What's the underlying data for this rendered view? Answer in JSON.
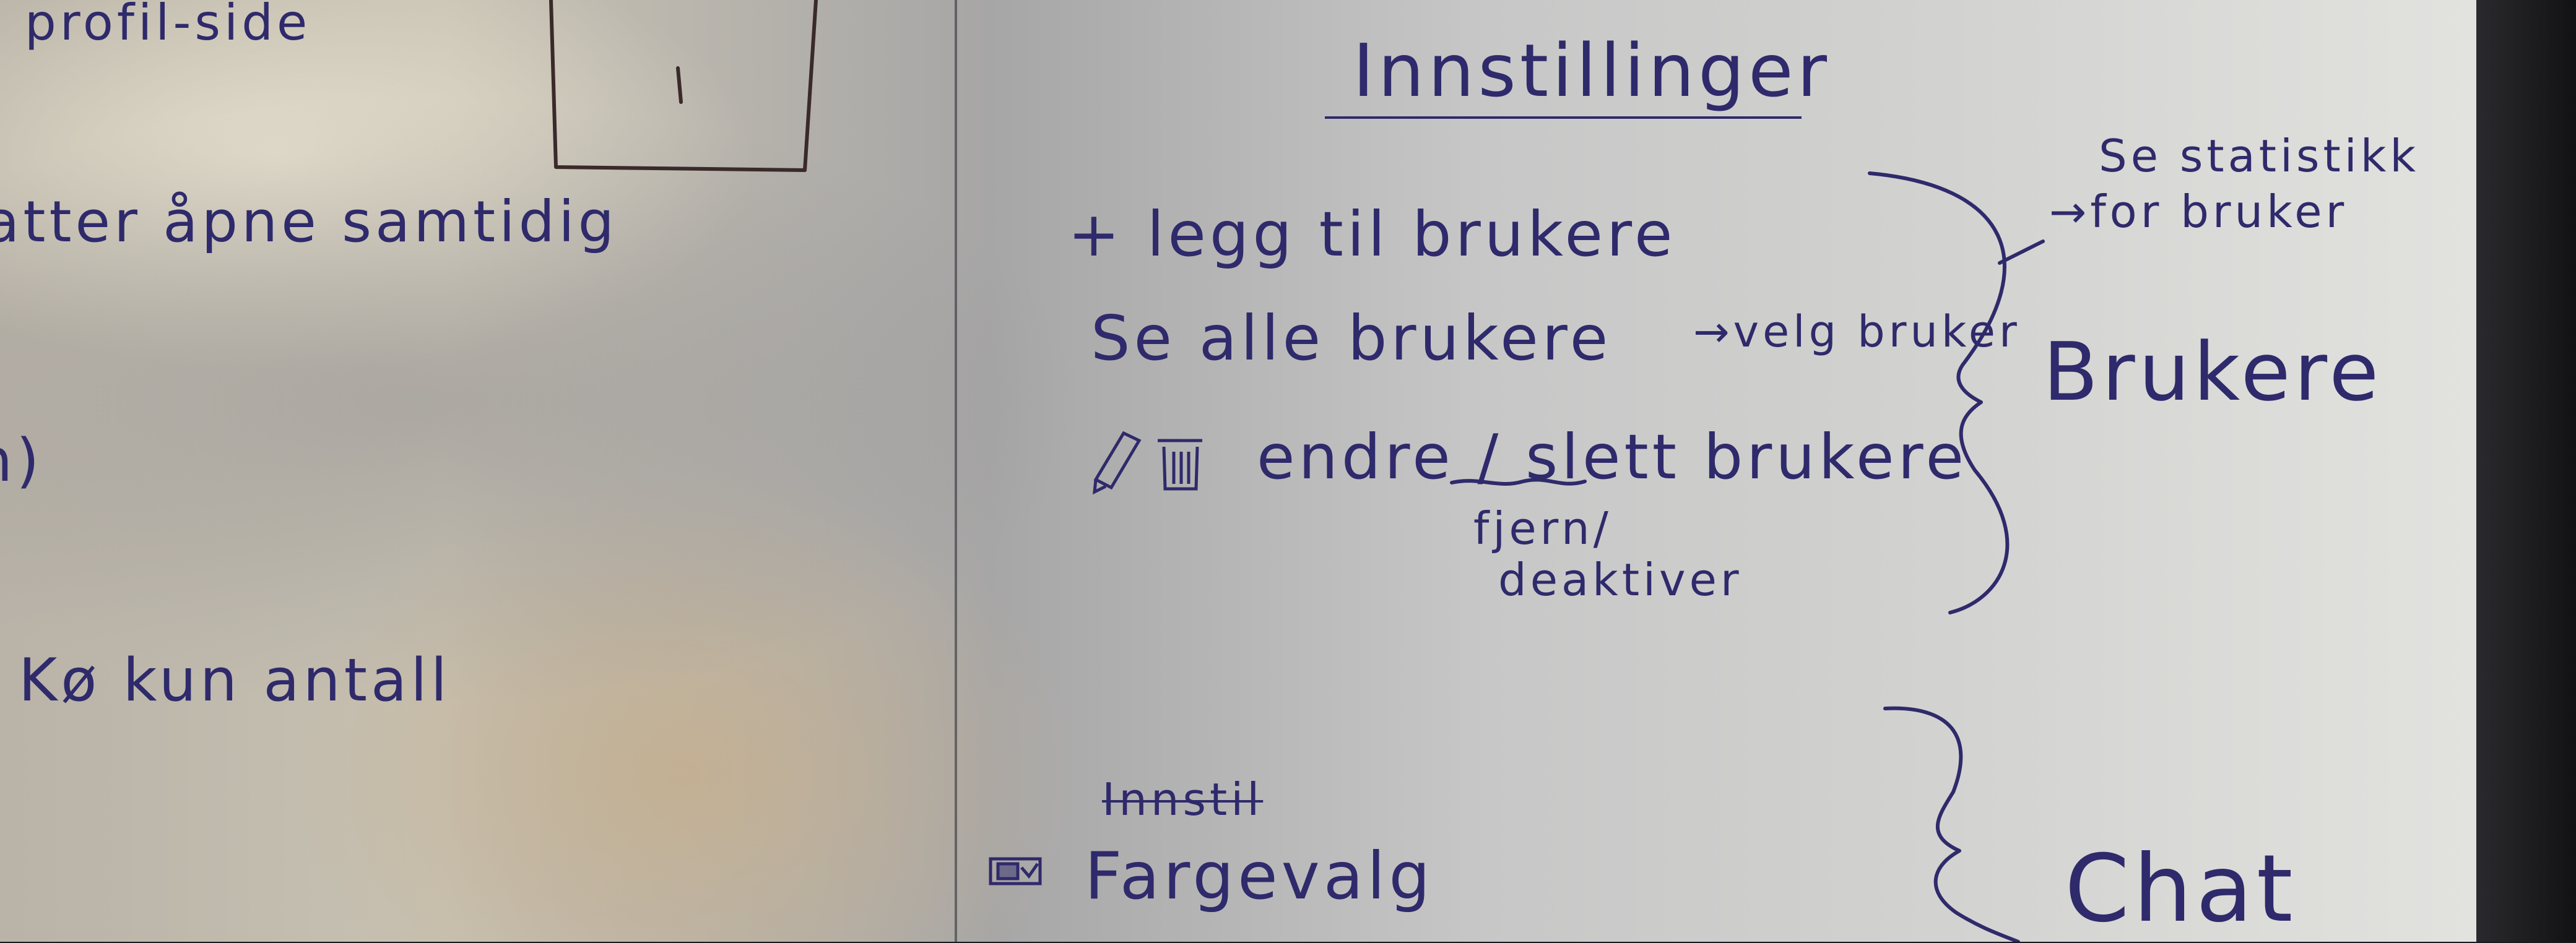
{
  "left_panel": {
    "profile_side": "profil-side",
    "parallel_open": "atter åpne samtidig",
    "paren_fragment": "n)",
    "queue_count": "Kø kun antall"
  },
  "settings": {
    "title": "Innstillinger",
    "add_users": "+ legg til brukere",
    "see_all_users": "Se alle brukere",
    "arrow_select": "→velg bruker",
    "edit_delete": "endre / slett brukere",
    "remove": "fjern/",
    "deactivate": "deaktiver",
    "see_stats": "Se statistikk",
    "for_user": "→for bruker",
    "group_users": "Brukere",
    "struck_word": "Innstil",
    "color_choice": "Fargevalg",
    "group_chat": "Chat"
  },
  "colors": {
    "ink": "#2f2a6b",
    "frame": "#3a2a2a"
  }
}
